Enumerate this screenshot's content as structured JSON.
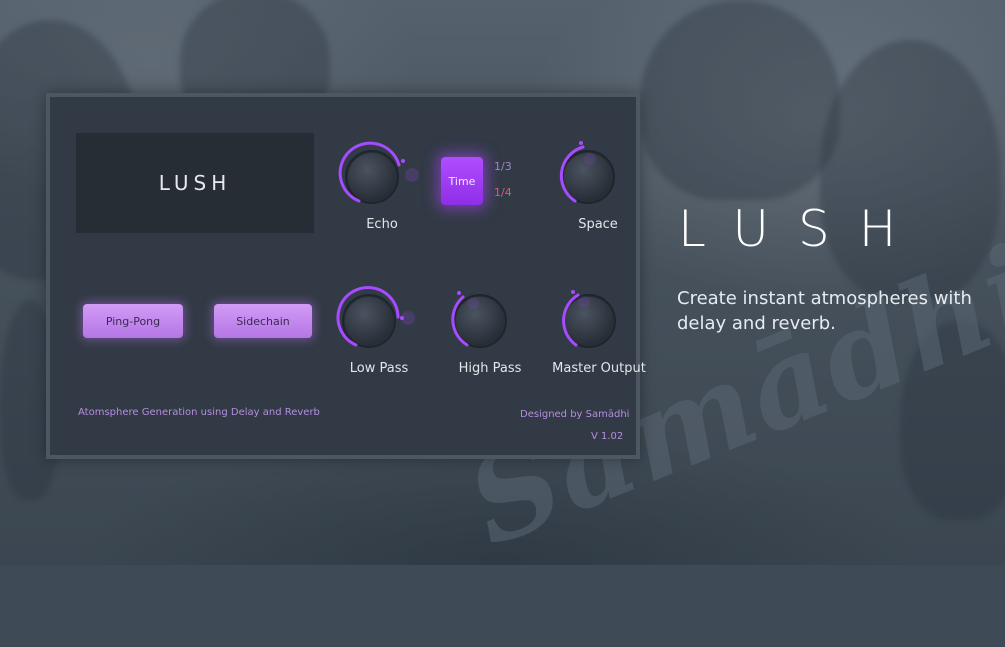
{
  "plugin": {
    "display_title": "LUSH",
    "knobs": {
      "echo": "Echo",
      "space": "Space",
      "low_pass": "Low Pass",
      "high_pass": "High Pass",
      "master_output": "Master Output"
    },
    "time_button": "Time",
    "time_options": [
      "1/3",
      "1/4"
    ],
    "buttons": {
      "ping_pong": "Ping-Pong",
      "sidechain": "Sidechain"
    },
    "footer": {
      "tagline": "Atomsphere Generation using Delay and Reverb",
      "designer": "Designed by Samādhi",
      "version": "V 1.02"
    }
  },
  "hero": {
    "title": "LUSH",
    "description": "Create instant atmospheres with delay and reverb."
  },
  "watermark": "Samādhi",
  "colors": {
    "accent": "#a64bff",
    "panel": "#323a45",
    "display": "#262d35",
    "pill": "#c58af0"
  }
}
